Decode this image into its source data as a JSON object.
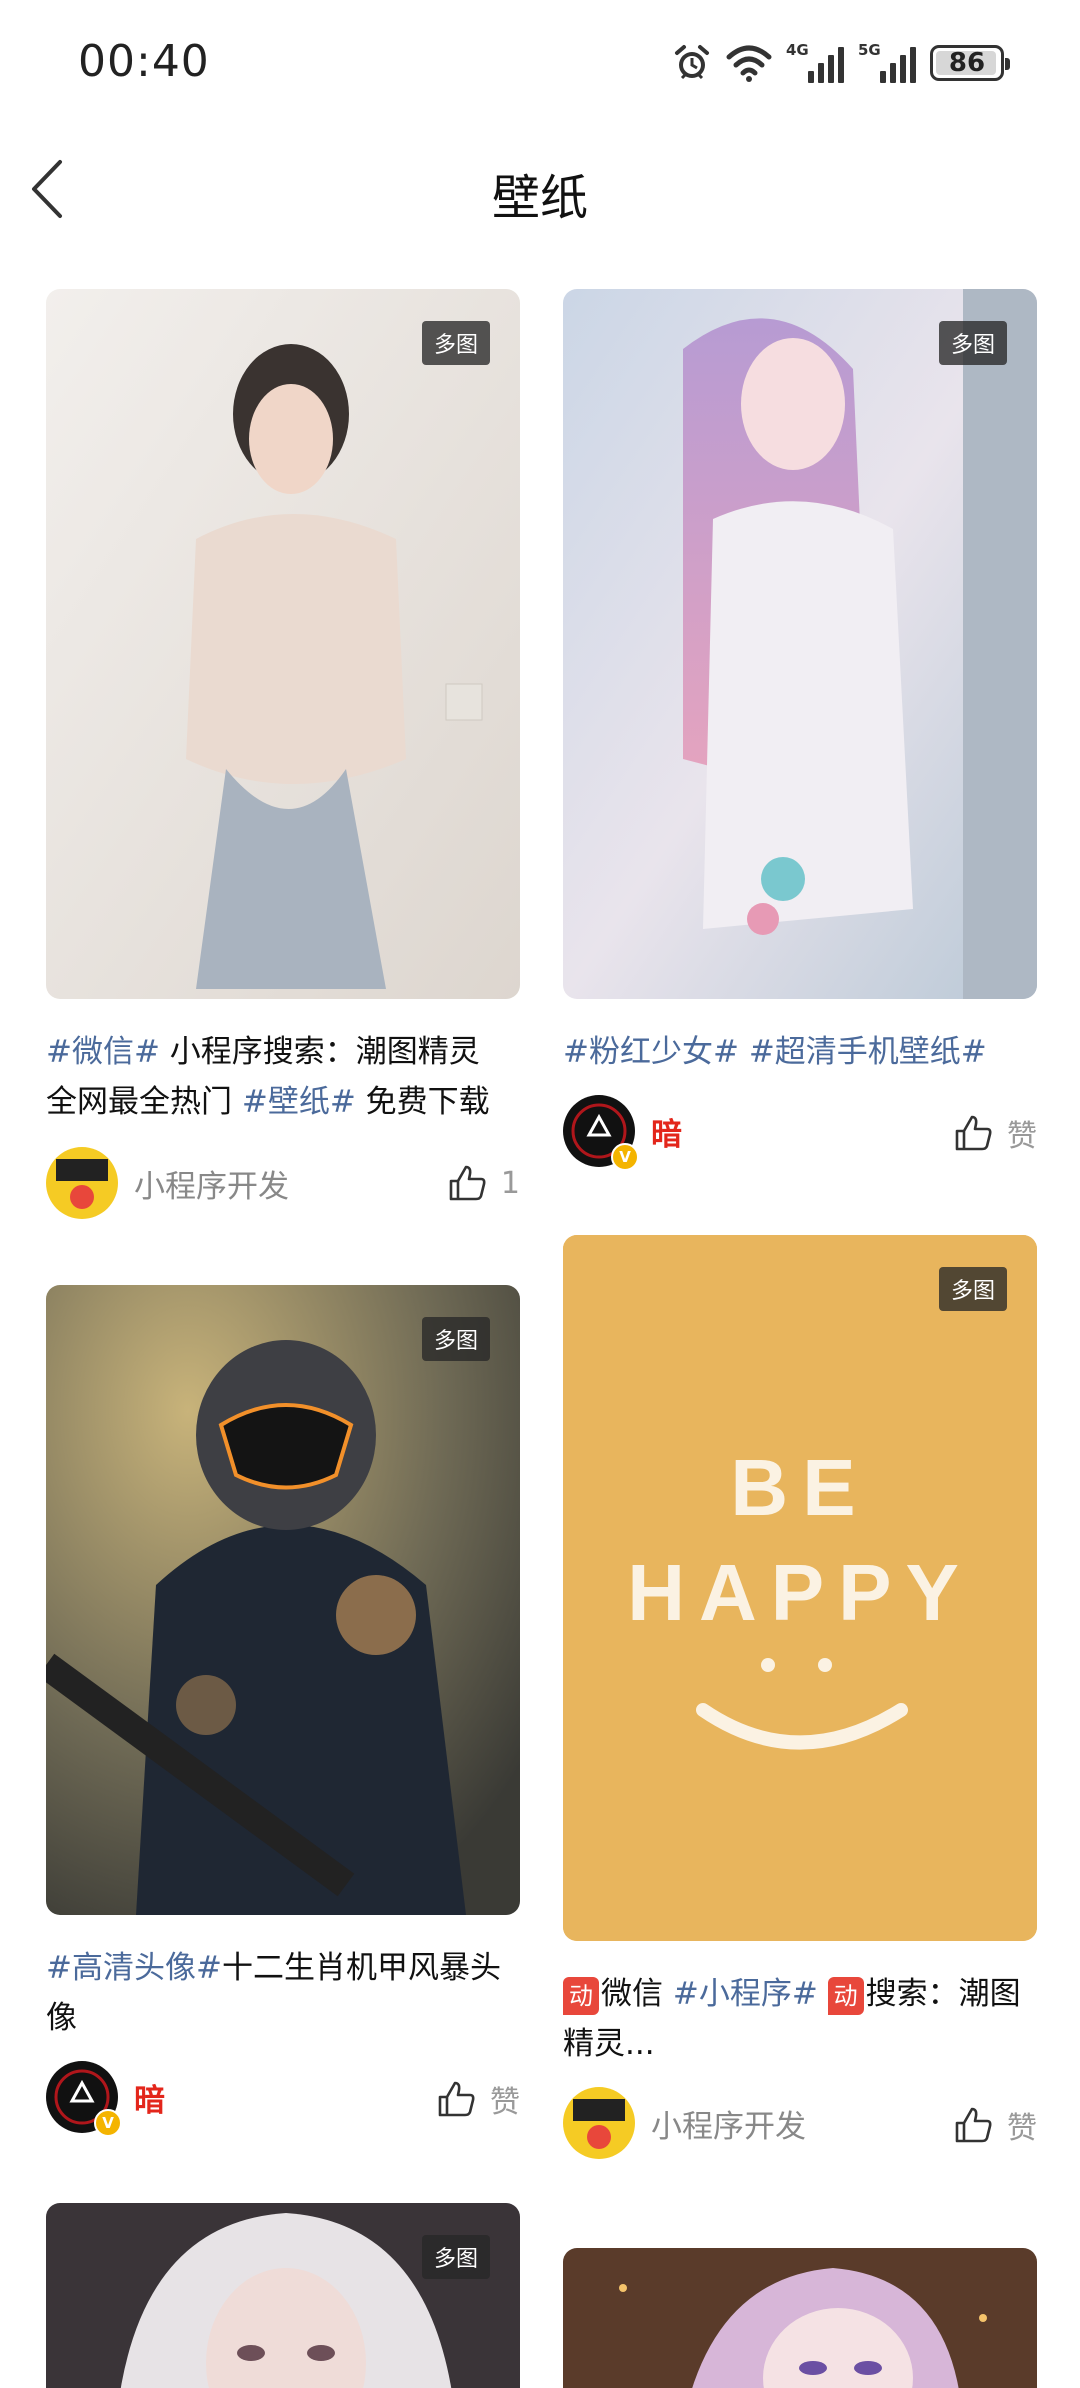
{
  "status_bar": {
    "time": "00:40",
    "battery": "86",
    "network_1": "4G",
    "network_2": "5G",
    "icons": [
      "alarm-icon",
      "wifi-icon",
      "signal-4g-icon",
      "signal-5g-icon",
      "battery-icon"
    ]
  },
  "header": {
    "title": "壁纸",
    "back_icon": "chevron-left-icon"
  },
  "badge_label": "多图",
  "cards": [
    {
      "caption_parts": [
        "#微信#",
        " 小程序搜索：潮图精灵全网最全热门 ",
        "#壁纸#",
        " 免费下载"
      ],
      "author": "小程序开发",
      "likes": "1",
      "avatar_text": "小程序开发"
    },
    {
      "caption_parts": [
        "#粉红少女#",
        " ",
        "#超清手机壁纸#"
      ],
      "author": "暗",
      "likes": "赞"
    },
    {
      "caption_parts": [
        "#高清头像#",
        "十二生肖机甲风暴头像"
      ],
      "author": "暗",
      "likes": "赞"
    },
    {
      "promo_label": "动",
      "caption_parts": [
        "微信 ",
        "#小程序#",
        " ",
        "搜索：潮图精灵..."
      ],
      "author": "小程序开发",
      "likes": "赞",
      "image_text": [
        "BE",
        "HAPPY"
      ],
      "image_color": "#e8b55d"
    }
  ],
  "colors": {
    "tag": "#4b6a9b",
    "author_highlight": "#e3261b",
    "promo": "#e8473b"
  }
}
